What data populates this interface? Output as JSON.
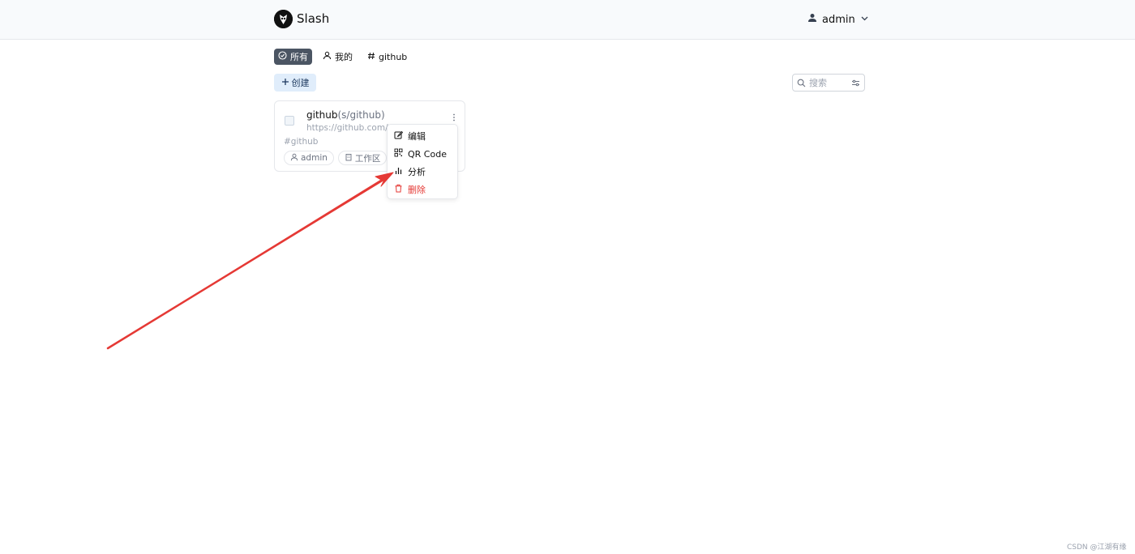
{
  "header": {
    "app_title": "Slash",
    "user_name": "admin"
  },
  "tabs": [
    {
      "label": "所有",
      "icon": "check-circle-icon",
      "active": true
    },
    {
      "label": "我的",
      "icon": "user-icon",
      "active": false
    },
    {
      "label": "github",
      "icon": "hash-icon",
      "active": false
    }
  ],
  "toolbar": {
    "create_label": "创建",
    "search_placeholder": "搜索"
  },
  "shortcut_card": {
    "name": "github",
    "slug": "(s/github)",
    "url": "https://github.com/",
    "tag": "#github",
    "creator": "admin",
    "visibility": "工作区"
  },
  "dropdown_menu": {
    "items": [
      {
        "label": "编辑",
        "icon": "edit-icon"
      },
      {
        "label": "QR Code",
        "icon": "qr-code-icon"
      },
      {
        "label": "分析",
        "icon": "bar-chart-icon"
      },
      {
        "label": "删除",
        "icon": "trash-icon",
        "color": "#e53935"
      }
    ]
  },
  "watermark": "CSDN @江湖有缘",
  "colors": {
    "active_tab_bg": "#4b5563",
    "create_button_bg": "#e0edfb",
    "danger": "#e53935",
    "annotation_arrow": "#e53935"
  }
}
